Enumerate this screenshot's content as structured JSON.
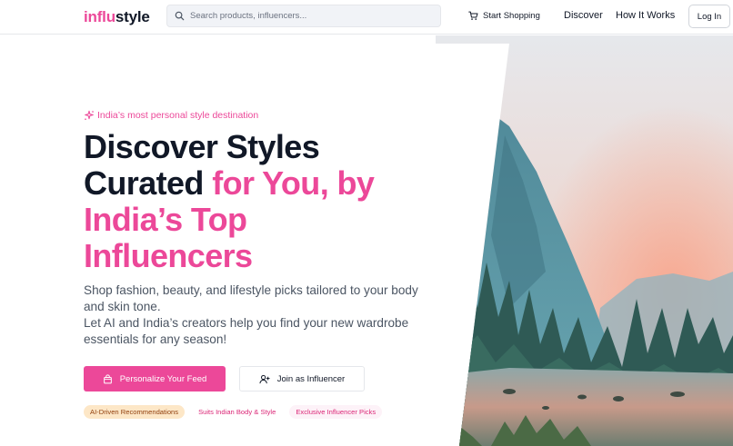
{
  "brand": {
    "part1": "influ",
    "part2": "style"
  },
  "search": {
    "placeholder": "Search products, influencers...",
    "value": ""
  },
  "nav": {
    "start_shopping": "Start Shopping",
    "discover": "Discover",
    "how_it_works": "How It Works",
    "login": "Log In"
  },
  "hero": {
    "tagline": "India’s most personal style destination",
    "headline": {
      "line1": "Discover Styles",
      "line2_dark": "Curated ",
      "line2_pink": "for You, by",
      "line3": "India’s Top",
      "line4": "Influencers"
    },
    "subtitle": {
      "line1": "Shop fashion, beauty, and lifestyle picks tailored to your body and skin tone.",
      "line2": "Let AI and India’s creators help you find your new wardrobe essentials for any season!"
    },
    "cta_primary": "Personalize Your Feed",
    "cta_secondary": "Join as Influencer",
    "badges": [
      "AI-Driven Recommendations",
      "Suits Indian Body & Style",
      "Exclusive Influencer Picks"
    ]
  },
  "colors": {
    "accent": "#ec4899",
    "text": "#111827",
    "muted": "#4b5563"
  },
  "icons": {
    "search": "search-icon",
    "cart": "cart-icon",
    "sparkles": "sparkles-icon",
    "bag": "shopping-bag-icon",
    "user_plus": "user-plus-icon"
  }
}
